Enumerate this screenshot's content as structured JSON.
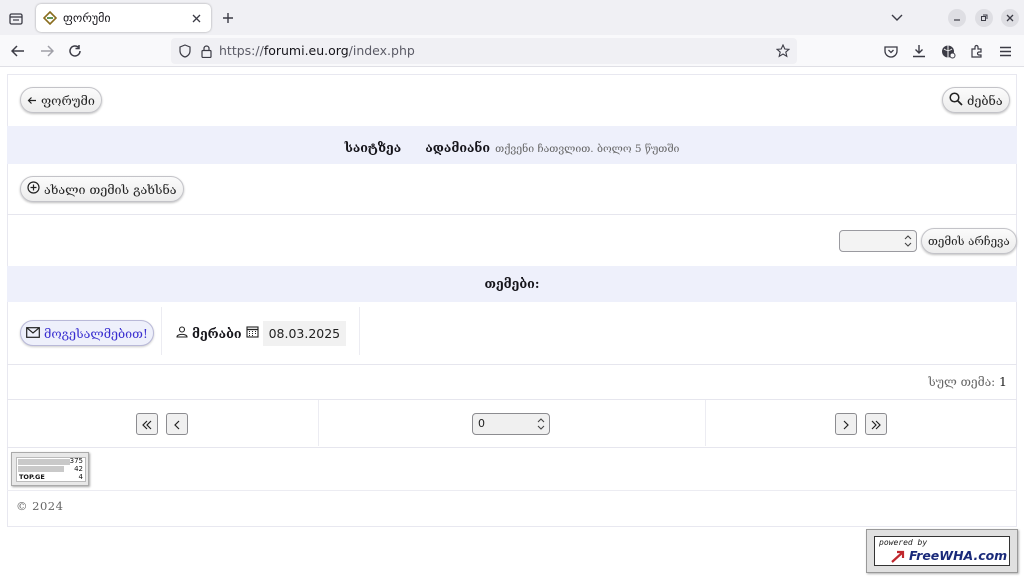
{
  "browser": {
    "tab_title": "ფორუმი",
    "url_scheme": "https://",
    "url_host": "forumi.eu.org",
    "url_path": "/index.php"
  },
  "header": {
    "back_label": "ფორუმი",
    "search_label": "ძებნა"
  },
  "info_band": {
    "online_label": "საიტზეა",
    "users": "ადამიანი",
    "note": "თქვენი ჩათვლით. ბოლო 5 წუთში"
  },
  "actions": {
    "new_topic_label": "ახალი თემის გახსნა",
    "topic_select_value": "",
    "choose_topic_label": "თემის არჩევა"
  },
  "topics": {
    "heading": "თემები:",
    "items": [
      {
        "title": "მოგესალმებით!",
        "author": "მერაბი",
        "date": "08.03.2025"
      }
    ],
    "total_label": "სულ თემა:",
    "total_count": "1"
  },
  "pager": {
    "page_value": "0"
  },
  "counter_widget": {
    "values": [
      "375",
      "42",
      "4"
    ],
    "logo": "TOP.GE"
  },
  "footer": {
    "copyright": "© 2024",
    "badge_small": "powered by",
    "badge_big": "FreeWHA.com"
  },
  "colors": {
    "band": "#eef0fb",
    "link": "#3a2fd0"
  }
}
